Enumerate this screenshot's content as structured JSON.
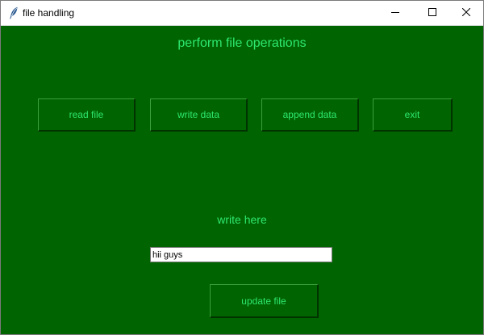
{
  "window": {
    "title": "file handling",
    "icon": "feather-icon",
    "controls": {
      "minimize": "minimize-icon",
      "maximize": "maximize-icon",
      "close": "close-icon"
    }
  },
  "main": {
    "heading": "perform file operations",
    "buttons": {
      "read": "read file",
      "write": "write data",
      "append": "append data",
      "exit": "exit"
    },
    "write_label": "write here",
    "entry_value": "hii guys",
    "update_button": "update file"
  },
  "colors": {
    "background": "#006400",
    "text": "#2ee870"
  }
}
